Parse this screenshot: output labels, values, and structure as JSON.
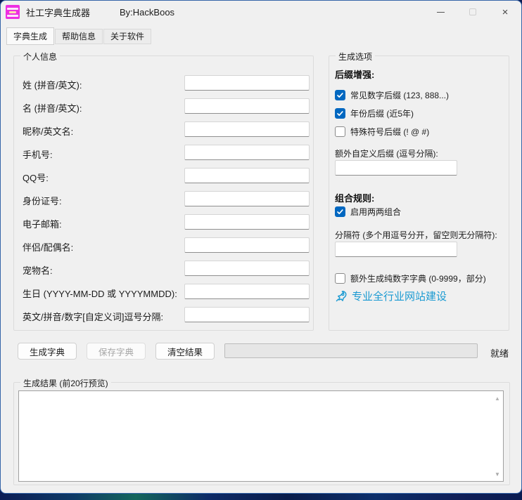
{
  "window": {
    "title": "社工字典生成器",
    "byline": "By:HackBoos",
    "controls": {
      "minimize": "–",
      "close": "×"
    }
  },
  "tabs": [
    {
      "label": "字典生成",
      "active": true
    },
    {
      "label": "帮助信息",
      "active": false
    },
    {
      "label": "关于软件",
      "active": false
    }
  ],
  "personal": {
    "legend": "个人信息",
    "fields": [
      {
        "label": "姓 (拼音/英文):",
        "value": ""
      },
      {
        "label": "名 (拼音/英文):",
        "value": ""
      },
      {
        "label": "昵称/英文名:",
        "value": ""
      },
      {
        "label": "手机号:",
        "value": ""
      },
      {
        "label": "QQ号:",
        "value": ""
      },
      {
        "label": "身份证号:",
        "value": ""
      },
      {
        "label": "电子邮箱:",
        "value": ""
      },
      {
        "label": "伴侣/配偶名:",
        "value": ""
      },
      {
        "label": "宠物名:",
        "value": ""
      },
      {
        "label": "生日 (YYYY-MM-DD 或 YYYYMMDD):",
        "value": ""
      },
      {
        "label": "英文/拼音/数字[自定义词]逗号分隔:",
        "value": ""
      }
    ]
  },
  "options": {
    "legend": "生成选项",
    "suffix_section_title": "后缀增强:",
    "suffix_checkboxes": [
      {
        "label": "常见数字后缀 (123, 888...)",
        "checked": true
      },
      {
        "label": "年份后缀 (近5年)",
        "checked": true
      },
      {
        "label": "特殊符号后缀 (! @ #)",
        "checked": false
      }
    ],
    "extra_suffix_label": "额外自定义后缀 (逗号分隔):",
    "extra_suffix_value": "",
    "combo_section_title": "组合规则:",
    "combo_checkbox": {
      "label": "启用两两组合",
      "checked": true
    },
    "separator_label": "分隔符 (多个用逗号分开，留空则无分隔符):",
    "separator_value": "",
    "numeric_checkbox": {
      "label": "额外生成纯数字字典 (0-9999，部分)",
      "checked": false
    },
    "promo_link": {
      "label": "专业全行业网站建设"
    }
  },
  "actions": {
    "generate": "生成字典",
    "save": "保存字典",
    "save_disabled": true,
    "clear": "清空结果",
    "progress_percent": 0,
    "status": "就绪"
  },
  "results": {
    "legend": "生成结果 (前20行预览)",
    "content": ""
  },
  "colors": {
    "checkbox_accent": "#0067c0",
    "link": "#1a9ad2",
    "app_icon": "#ee2fe2"
  }
}
